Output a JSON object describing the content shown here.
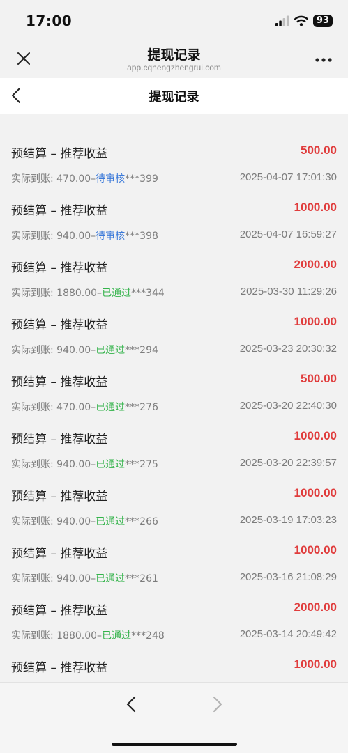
{
  "status_bar": {
    "time": "17:00",
    "battery": "93"
  },
  "webview": {
    "title": "提现记录",
    "url": "app.cqhengzhengrui.com"
  },
  "page": {
    "title": "提现记录"
  },
  "records": [
    {
      "title": "预结算 – 推荐收益",
      "amount": "500.00",
      "detail_prefix": "实际到账: 470.00–",
      "status": "待审核",
      "status_type": "pending",
      "detail_suffix": "***399",
      "time": "2025-04-07 17:01:30"
    },
    {
      "title": "预结算 – 推荐收益",
      "amount": "1000.00",
      "detail_prefix": "实际到账: 940.00–",
      "status": "待审核",
      "status_type": "pending",
      "detail_suffix": "***398",
      "time": "2025-04-07 16:59:27"
    },
    {
      "title": "预结算 – 推荐收益",
      "amount": "2000.00",
      "detail_prefix": "实际到账: 1880.00–",
      "status": "已通过",
      "status_type": "passed",
      "detail_suffix": "***344",
      "time": "2025-03-30 11:29:26"
    },
    {
      "title": "预结算 – 推荐收益",
      "amount": "1000.00",
      "detail_prefix": "实际到账: 940.00–",
      "status": "已通过",
      "status_type": "passed",
      "detail_suffix": "***294",
      "time": "2025-03-23 20:30:32"
    },
    {
      "title": "预结算 – 推荐收益",
      "amount": "500.00",
      "detail_prefix": "实际到账: 470.00–",
      "status": "已通过",
      "status_type": "passed",
      "detail_suffix": "***276",
      "time": "2025-03-20 22:40:30"
    },
    {
      "title": "预结算 – 推荐收益",
      "amount": "1000.00",
      "detail_prefix": "实际到账: 940.00–",
      "status": "已通过",
      "status_type": "passed",
      "detail_suffix": "***275",
      "time": "2025-03-20 22:39:57"
    },
    {
      "title": "预结算 – 推荐收益",
      "amount": "1000.00",
      "detail_prefix": "实际到账: 940.00–",
      "status": "已通过",
      "status_type": "passed",
      "detail_suffix": "***266",
      "time": "2025-03-19 17:03:23"
    },
    {
      "title": "预结算 – 推荐收益",
      "amount": "1000.00",
      "detail_prefix": "实际到账: 940.00–",
      "status": "已通过",
      "status_type": "passed",
      "detail_suffix": "***261",
      "time": "2025-03-16 21:08:29"
    },
    {
      "title": "预结算 – 推荐收益",
      "amount": "2000.00",
      "detail_prefix": "实际到账: 1880.00–",
      "status": "已通过",
      "status_type": "passed",
      "detail_suffix": "***248",
      "time": "2025-03-14 20:49:42"
    },
    {
      "title": "预结算 – 推荐收益",
      "amount": "1000.00",
      "detail_prefix": "",
      "status": "",
      "status_type": "",
      "detail_suffix": "",
      "time": ""
    }
  ],
  "colors": {
    "amount": "#e03c3c",
    "pending": "#3c7ad9",
    "passed": "#33b34a"
  },
  "icons": {
    "close": "close-icon",
    "more": "more-icon",
    "back": "chevron-left-icon",
    "nav_back": "nav-back-icon",
    "nav_forward": "nav-forward-icon"
  }
}
